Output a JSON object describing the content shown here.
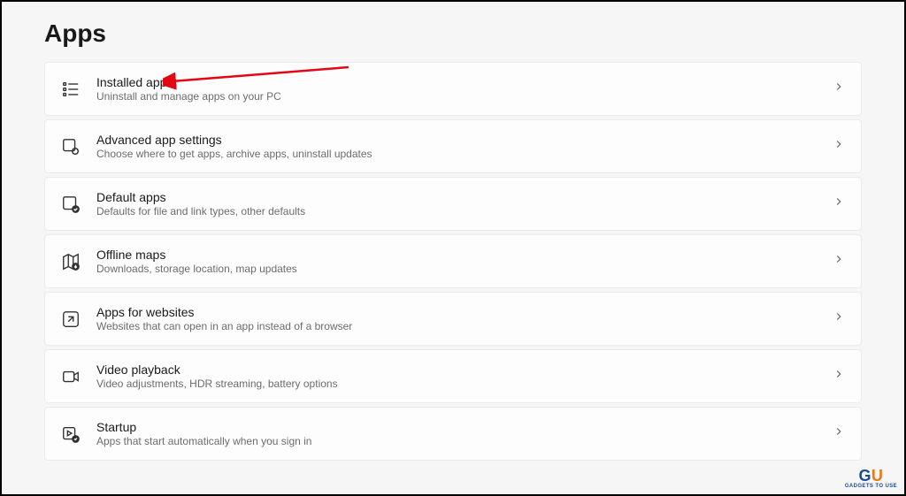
{
  "header": {
    "title": "Apps"
  },
  "items": [
    {
      "title": "Installed apps",
      "desc": "Uninstall and manage apps on your PC"
    },
    {
      "title": "Advanced app settings",
      "desc": "Choose where to get apps, archive apps, uninstall updates"
    },
    {
      "title": "Default apps",
      "desc": "Defaults for file and link types, other defaults"
    },
    {
      "title": "Offline maps",
      "desc": "Downloads, storage location, map updates"
    },
    {
      "title": "Apps for websites",
      "desc": "Websites that can open in an app instead of a browser"
    },
    {
      "title": "Video playback",
      "desc": "Video adjustments, HDR streaming, battery options"
    },
    {
      "title": "Startup",
      "desc": "Apps that start automatically when you sign in"
    }
  ]
}
